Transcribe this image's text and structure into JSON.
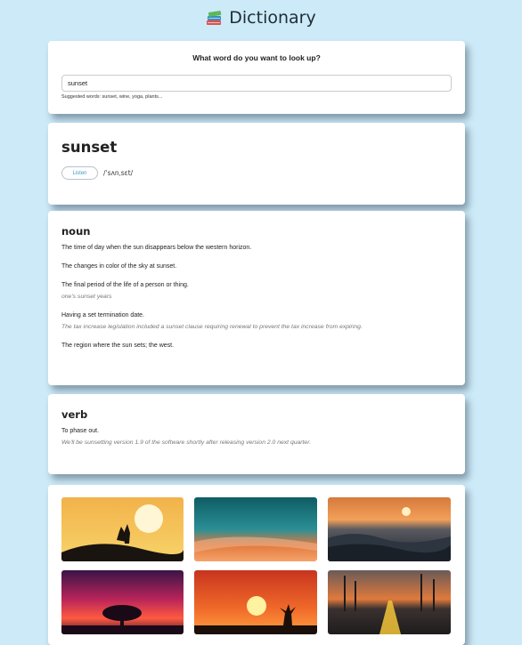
{
  "app": {
    "title": "Dictionary",
    "icon": "books-icon"
  },
  "search": {
    "question": "What word do you want to look up?",
    "value": "sunset",
    "suggestions": "Suggested words: sunset, wine, yoga, plants..."
  },
  "word": {
    "title": "sunset",
    "listen_label": "Listen",
    "phonetic": "/ˈsʌnˌsɛt/"
  },
  "meanings": {
    "noun": {
      "part_of_speech": "noun",
      "definitions": [
        {
          "text": "The time of day when the sun disappears below the western horizon."
        },
        {
          "text": "The changes in color of the sky at sunset."
        },
        {
          "text": "The final period of the life of a person or thing.",
          "example": "one's sunset years"
        },
        {
          "text": "Having a set termination date.",
          "example": "The tax increase legislation included a sunset clause requiring renewal to prevent the tax increase from expiring."
        },
        {
          "text": "The region where the sun sets; the west."
        }
      ]
    },
    "verb": {
      "part_of_speech": "verb",
      "definitions": [
        {
          "text": "To phase out.",
          "example": "We'll be sunsetting version 1.9 of the software shortly after releasing version 2.0 next quarter."
        }
      ]
    }
  },
  "photos": [
    {
      "name": "couple-silhouette-sunset-photo",
      "colors": [
        "#f6c24a",
        "#e8a63a"
      ]
    },
    {
      "name": "teal-orange-sky-photo",
      "colors": [
        "#1d6f78",
        "#e06b3a"
      ]
    },
    {
      "name": "ocean-waves-sunset-photo",
      "colors": [
        "#d98a4a",
        "#2e3640"
      ]
    },
    {
      "name": "magenta-sky-tree-photo",
      "colors": [
        "#a0205a",
        "#ff5a3a"
      ]
    },
    {
      "name": "orange-sun-tree-photo",
      "colors": [
        "#e8502a",
        "#ffb347"
      ]
    },
    {
      "name": "road-palm-trees-sunset-photo",
      "colors": [
        "#c06030",
        "#2a2a2a"
      ]
    }
  ]
}
